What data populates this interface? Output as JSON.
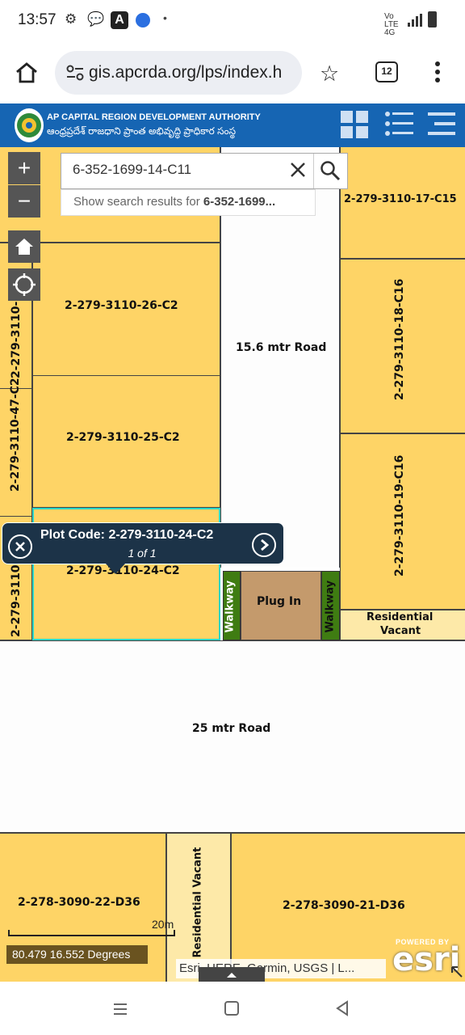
{
  "status": {
    "time": "13:57",
    "network": "Vo LTE 4G"
  },
  "browser": {
    "url": "gis.apcrda.org/lps/index.h",
    "tab_count": "12"
  },
  "header": {
    "title_en": "AP CAPITAL REGION DEVELOPMENT AUTHORITY",
    "title_te": "ఆంధ్రప్రదేశ్ రాజధాని ప్రాంత అభివృద్ధి ప్రాధికార సంస్థ"
  },
  "search": {
    "value": "6-352-1699-14-C11",
    "suggestion_prefix": "Show search results for ",
    "suggestion_term": "6-352-1699..."
  },
  "map_controls": {
    "zoom_in": "+",
    "zoom_out": "−"
  },
  "parcels": {
    "p26": "2-279-3110-26-C2",
    "p25": "2-279-3110-25-C2",
    "p24": "2-279-3110-24-C2",
    "p47": "2-279-3110-47-C2",
    "p_left_top": "2-279-3110-",
    "p_left_top2": "9-",
    "p_left_bottom": "2-279-3110",
    "p17": "2-279-3110-17-C15",
    "p18": "2-279-3110-18-C16",
    "p19": "2-279-3110-19-C16",
    "d22": "2-278-3090-22-D36",
    "d21": "2-278-3090-21-D36"
  },
  "labels": {
    "road_15": "15.6 mtr Road",
    "road_25": "25 mtr Road",
    "plug_in": "Plug In",
    "walkway": "Walkway",
    "res_vacant_1": "Residential",
    "res_vacant_2": "Vacant",
    "res_vacant_v": "Residential Vacant"
  },
  "popup": {
    "title": "Plot Code: 2-279-3110-24-C2",
    "count": "1 of 1"
  },
  "scale": {
    "label": "20m"
  },
  "coordinates": "80.479 16.552 Degrees",
  "attribution": "Esri, HERE, Garmin, USGS | L...",
  "esri": {
    "powered": "POWERED BY",
    "logo": "esri"
  }
}
